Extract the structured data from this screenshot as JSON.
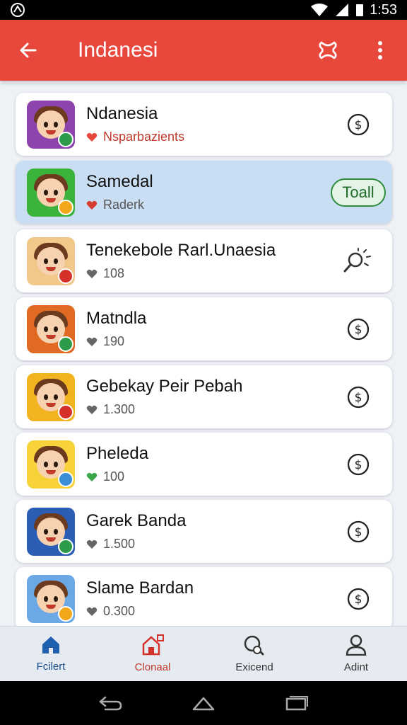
{
  "status": {
    "time": "1:53"
  },
  "app_bar": {
    "title": "Indanesi"
  },
  "items": [
    {
      "name": "Ndanesia",
      "sub": "Nsparbazients",
      "sub_style": "red",
      "heart_color": "#e8483c",
      "bg": "#8e44ad",
      "badge": "#2e9b4a",
      "trail": "dollar"
    },
    {
      "name": "Samedal",
      "sub": "Raderk",
      "sub_style": "gray",
      "heart_color": "#d63b2f",
      "bg": "#3bb33b",
      "badge": "#f2a71b",
      "trail": "toll",
      "trail_label": "Toall",
      "selected": true
    },
    {
      "name": "Tenekebole Rarl.Unaesia",
      "sub": "108",
      "sub_style": "gray",
      "heart_color": "#666666",
      "bg": "#f1c88a",
      "badge": "#d6302b",
      "trail": "search"
    },
    {
      "name": "Matndla",
      "sub": "190",
      "sub_style": "gray",
      "heart_color": "#666666",
      "bg": "#e06a22",
      "badge": "#2e9b4a",
      "trail": "dollar"
    },
    {
      "name": "Gebekay Peir Pebah",
      "sub": "1.300",
      "sub_style": "gray",
      "heart_color": "#666666",
      "bg": "#f2b321",
      "badge": "#d6302b",
      "trail": "dollar"
    },
    {
      "name": "Pheleda",
      "sub": "100",
      "sub_style": "gray",
      "heart_color": "#3aa64a",
      "bg": "#f7d23a",
      "badge": "#3a8fd6",
      "trail": "dollar"
    },
    {
      "name": "Garek Banda",
      "sub": "1.500",
      "sub_style": "gray",
      "heart_color": "#666666",
      "bg": "#2c5db5",
      "badge": "#2e9b4a",
      "trail": "dollar"
    },
    {
      "name": "Slame Bardan",
      "sub": "0.300",
      "sub_style": "gray",
      "heart_color": "#666666",
      "bg": "#6aa9e6",
      "badge": "#f2a71b",
      "trail": "dollar"
    }
  ],
  "bottom_nav": [
    {
      "label": "Fcilert",
      "icon": "home-icon"
    },
    {
      "label": "Clonaal",
      "icon": "store-icon"
    },
    {
      "label": "Exicend",
      "icon": "search-icon"
    },
    {
      "label": "Adint",
      "icon": "person-icon"
    }
  ]
}
